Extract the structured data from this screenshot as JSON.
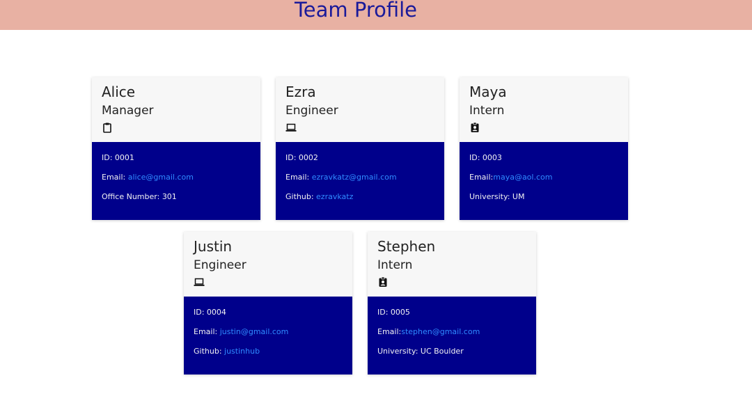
{
  "header": {
    "title": "Team Profile"
  },
  "labels": {
    "id": "ID:",
    "email": "Email:",
    "office": "Office Number:",
    "github": "Github:",
    "university": "University:"
  },
  "colors": {
    "header_bg": "#e8b1a3",
    "title": "#1a1a9a",
    "card_top": "#f7f7f7",
    "card_bottom": "#00008b",
    "link": "#2f8bff"
  },
  "employees": [
    {
      "name": "Alice",
      "role": "Manager",
      "icon": "clipboard-icon",
      "id": "0001",
      "email": "alice@gmail.com",
      "office_number": "301"
    },
    {
      "name": "Ezra",
      "role": "Engineer",
      "icon": "laptop-icon",
      "id": "0002",
      "email": "ezravkatz@gmail.com",
      "github": "ezravkatz"
    },
    {
      "name": "Maya",
      "role": "Intern",
      "icon": "id-badge-icon",
      "id": "0003",
      "email": "maya@aol.com",
      "university": "UM"
    },
    {
      "name": "Justin",
      "role": "Engineer",
      "icon": "laptop-icon",
      "id": "0004",
      "email": "justin@gmail.com",
      "github": "justinhub"
    },
    {
      "name": "Stephen",
      "role": "Intern",
      "icon": "id-badge-icon",
      "id": "0005",
      "email": "stephen@gmail.com",
      "university": "UC Boulder"
    }
  ]
}
